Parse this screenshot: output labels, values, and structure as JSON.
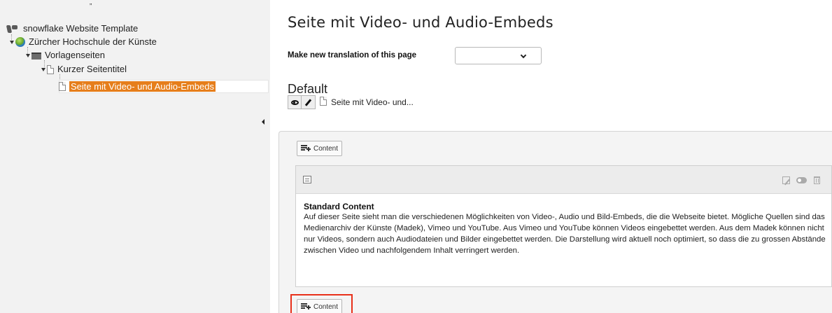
{
  "tree": {
    "corner_mark": "„",
    "root": {
      "label": "snowflake Website Template",
      "icon": "typo3-logo-icon"
    },
    "items": [
      {
        "label": "Zürcher Hochschule der Künste",
        "icon": "globe-icon"
      },
      {
        "label": "Vorlagenseiten",
        "icon": "folder-icon"
      },
      {
        "label": "Kurzer Seitentitel",
        "icon": "page-icon"
      },
      {
        "label": "Seite mit Video- und Audio-Embeds",
        "icon": "page-icon",
        "selected": true
      }
    ],
    "selection_color": "#e67e1b"
  },
  "page": {
    "title": "Seite mit Video- und Audio-Embeds",
    "translation": {
      "label": "Make new translation of this page",
      "selected_value": ""
    },
    "language_heading": "Default",
    "page_short_title": "Seite mit Video- und..."
  },
  "content": {
    "add_content_label": "Content",
    "element": {
      "title": "Standard Content",
      "text": "Auf dieser Seite sieht man die verschiedenen Möglichkeiten von Video-, Audio und Bild-Embeds, die die Webseite bietet. Mögliche Quellen sind das Medienarchiv der Künste (Madek), Vimeo und YouTube. Aus Vimeo und YouTube können Videos eingebettet werden. Aus dem Madek können nicht nur Videos, sondern auch Audiodateien und Bilder eingebettet werden. Die Darstellung wird aktuell noch optimiert, so dass die zu grossen Abstände zwischen Video und nachfolgendem Inhalt verringert werden."
    },
    "highlight_color": "#e8301a"
  }
}
